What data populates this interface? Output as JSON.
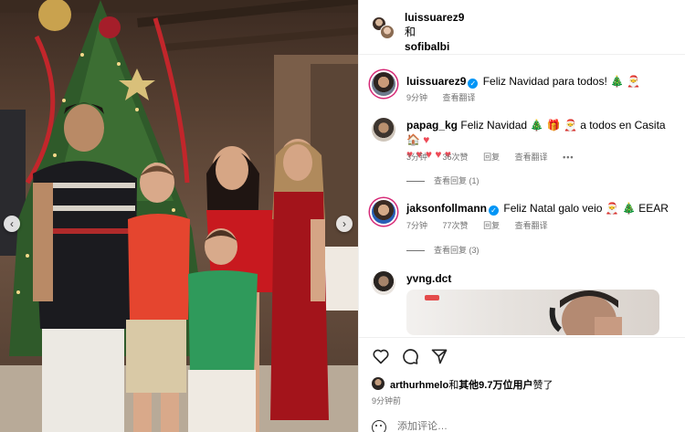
{
  "photo": {
    "nav_left_icon": "chevron-left-icon",
    "nav_right_icon": "chevron-right-icon",
    "nav_left_glyph": "‹",
    "nav_right_glyph": "›"
  },
  "header": {
    "user1": "luissuarez9",
    "joiner": "和",
    "user2": "sofibalbi"
  },
  "colors": {
    "verified": "#0095f6",
    "secondary_text": "#737373",
    "heart": "#ed4956",
    "story_ring": "#d62976"
  },
  "caption": {
    "username": "luissuarez9",
    "text": "Feliz Navidad para todos! 🎄 🎅",
    "time": "9分钟",
    "translate": "查看翻译"
  },
  "comments": [
    {
      "username": "papag_kg",
      "text_line1": "Feliz Navidad 🎄 🎁 🎅 a todos en Casita 🏠",
      "hearts": "♥ ♥ ♥ ♥ ♥",
      "time": "3分钟",
      "likes": "36次赞",
      "reply": "回复",
      "translate": "查看翻译",
      "more": "•••",
      "view_replies": "查看回复 (1)"
    },
    {
      "username": "jaksonfollmann",
      "text_line1": "Feliz Natal galo veio 🎅 🎄 EEAR",
      "time": "7分钟",
      "likes": "77次赞",
      "reply": "回复",
      "translate": "查看翻译",
      "view_replies": "查看回复 (3)"
    },
    {
      "username": "yvng.dct"
    }
  ],
  "actions": {
    "like_icon": "heart-icon",
    "comment_icon": "comment-icon",
    "share_icon": "share-icon"
  },
  "likes": {
    "user": "arthurhmelo",
    "joiner": "和",
    "others": "其他9.7万位用户",
    "suffix": "赞了",
    "time": "9分钟前"
  },
  "add_comment": {
    "placeholder": "添加评论…",
    "icon": "emoji-icon"
  }
}
